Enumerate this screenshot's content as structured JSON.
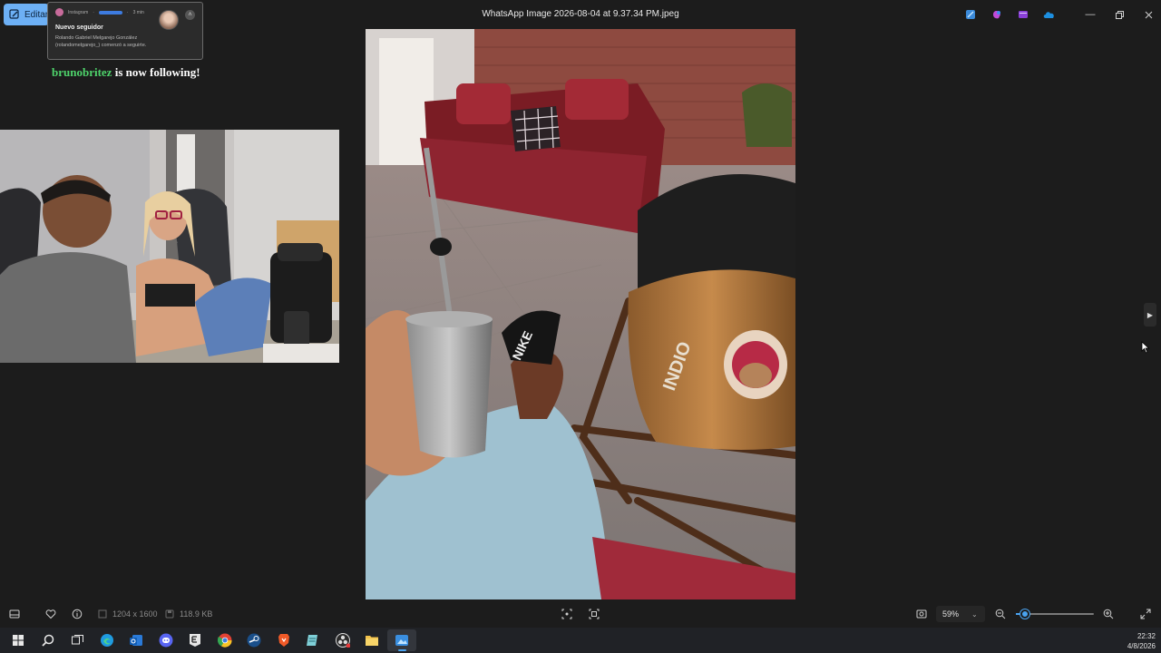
{
  "titlebar": {
    "edit_label": "Editar",
    "title": "WhatsApp Image 2026-08-04 at 9.37.34 PM.jpeg",
    "pinned_apps": [
      "photos-edit-icon",
      "copilot-icon",
      "clipchamp-icon",
      "onedrive-icon"
    ]
  },
  "notification": {
    "app": "Instagram",
    "time": "3 min",
    "title": "Nuevo seguidor",
    "body": "Rolando Gabriel Melgarejo González (rolandomelgarejo_) comenzó a seguirte."
  },
  "overlay": {
    "username": "brunobritez",
    "follow_text": " is now following!"
  },
  "status": {
    "dimensions": "1204 x 1600",
    "filesize": "118.9 KB",
    "zoom": "59%",
    "zoom_fraction": 0.12
  },
  "taskbar": {
    "time": "22:32",
    "date": "4/8/2026",
    "apps": [
      "windows-start-icon",
      "search-icon",
      "task-view-icon",
      "edge-icon",
      "outlook-icon",
      "discord-icon",
      "epic-games-icon",
      "chrome-icon",
      "steam-icon",
      "brave-icon",
      "notepad-icon",
      "obs-icon",
      "file-explorer-icon",
      "photos-icon"
    ]
  },
  "colors": {
    "accent": "#4aa3f0",
    "follow_user": "#4ed36b",
    "background": "#1c1c1c"
  }
}
